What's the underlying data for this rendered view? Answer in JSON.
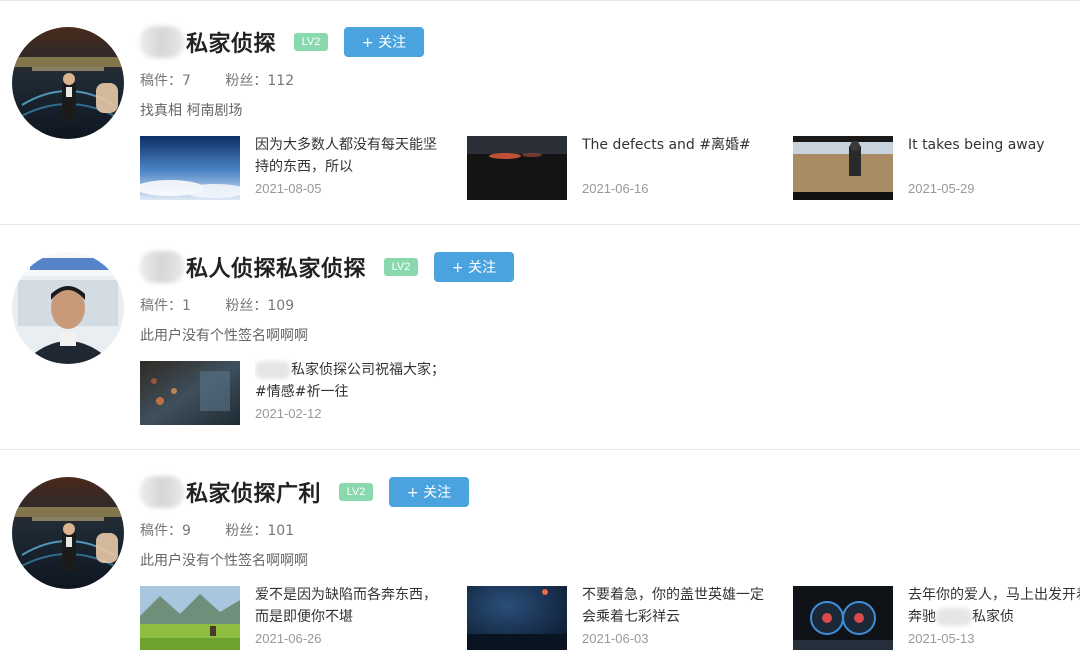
{
  "users": [
    {
      "name": "私家侦探",
      "level": "LV2",
      "follow_label": "+ 关注",
      "stats": {
        "works": "稿件：7",
        "fans": "粉丝：112"
      },
      "sign": "找真相 柯南剧场",
      "videos": [
        {
          "title": "因为大多数人都没有每天能坚持的东西，所以",
          "date": "2021-08-05"
        },
        {
          "title": "The defects and #离婚#",
          "date": "2021-06-16"
        },
        {
          "title": "It takes being away",
          "date": "2021-05-29"
        }
      ]
    },
    {
      "name": "私人侦探私家侦探",
      "level": "LV2",
      "follow_label": "+ 关注",
      "stats": {
        "works": "稿件：1",
        "fans": "粉丝：109"
      },
      "sign": "此用户没有个性签名啊啊啊",
      "videos": [
        {
          "title_suffix": "私家侦探公司祝福大家；#情感#祈一往",
          "date": "2021-02-12"
        }
      ]
    },
    {
      "name": "私家侦探广利",
      "level": "LV2",
      "follow_label": "+ 关注",
      "stats": {
        "works": "稿件：9",
        "fans": "粉丝：101"
      },
      "sign": "此用户没有个性签名啊啊啊",
      "videos": [
        {
          "title": "爱不是因为缺陷而各奔东西，而是即便你不堪",
          "date": "2021-06-26"
        },
        {
          "title": "不要着急，你的盖世英雄一定会乘着七彩祥云",
          "date": "2021-06-03"
        },
        {
          "title_prefix": "去年你的爱人，马上出发开着奔驰",
          "title_suffix": "私家侦",
          "date": "2021-05-13"
        }
      ]
    }
  ]
}
